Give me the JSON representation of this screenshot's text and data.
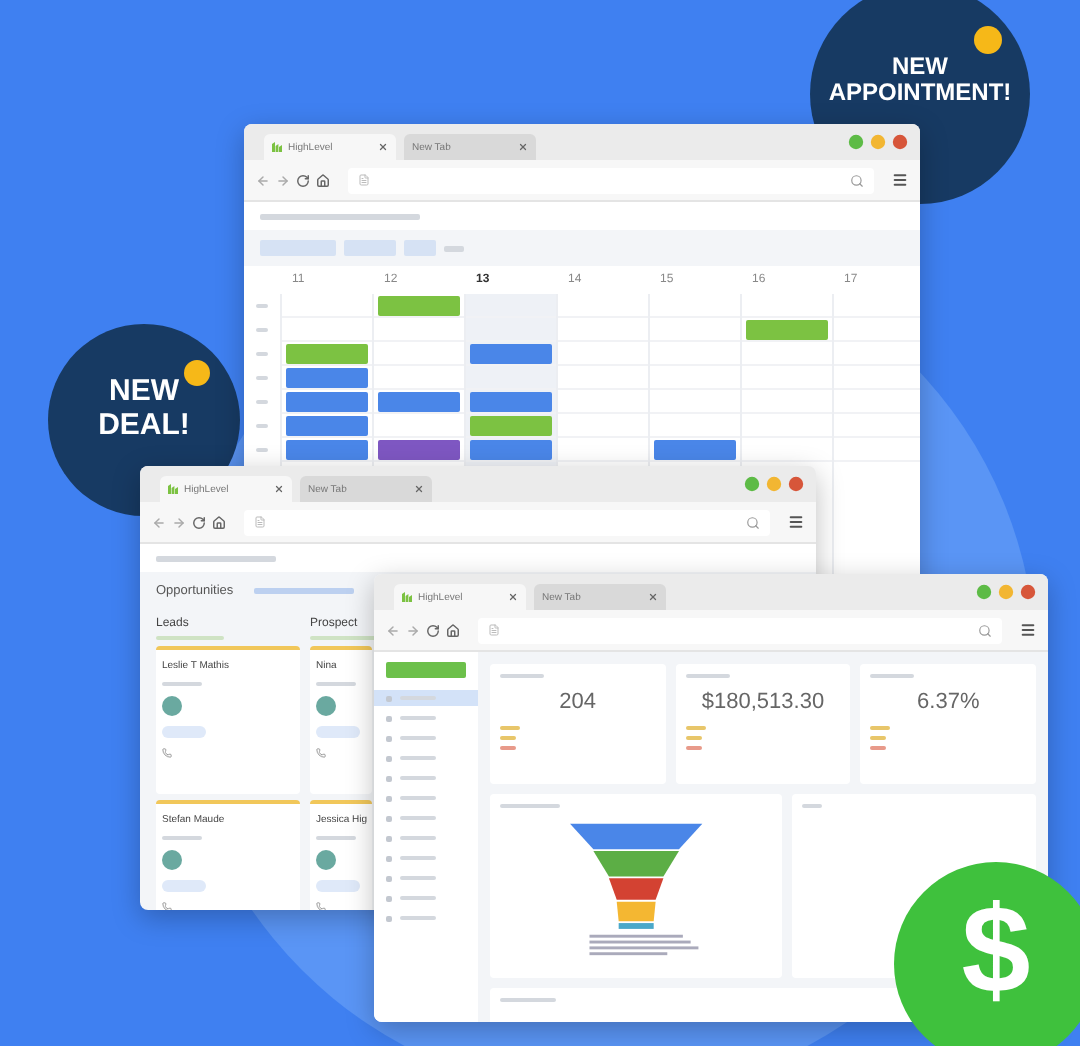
{
  "callouts": [
    {
      "lines": [
        "NEW",
        "APPOINTMENT!"
      ],
      "kind": "appointment"
    },
    {
      "lines": [
        "NEW",
        "DEAL!"
      ],
      "kind": "deal"
    }
  ],
  "windows": [
    {
      "kind": "calendar",
      "tabs": [
        {
          "label": "HighLevel",
          "favicon": true,
          "selected": true
        },
        {
          "label": "New Tab",
          "favicon": false,
          "selected": false
        }
      ],
      "calendar": {
        "days": [
          {
            "day": "11",
            "today": false,
            "slots": [
              {
                "kind": "free"
              },
              {
                "kind": "free"
              },
              {
                "kind": "event",
                "color": "#7cc242"
              },
              {
                "kind": "event",
                "color": "#4a86e8"
              },
              {
                "kind": "event",
                "color": "#4a86e8"
              },
              {
                "kind": "event",
                "color": "#4a86e8"
              },
              {
                "kind": "event",
                "color": "#4a86e8"
              }
            ]
          },
          {
            "day": "12",
            "today": false,
            "slots": [
              {
                "kind": "event",
                "color": "#7cc242"
              },
              {
                "kind": "free"
              },
              {
                "kind": "free"
              },
              {
                "kind": "free"
              },
              {
                "kind": "event",
                "color": "#4a86e8"
              },
              {
                "kind": "free"
              },
              {
                "kind": "event",
                "color": "#7e57c2"
              }
            ]
          },
          {
            "day": "13",
            "today": true,
            "slots": [
              {
                "kind": "free"
              },
              {
                "kind": "free"
              },
              {
                "kind": "event",
                "color": "#4a86e8"
              },
              {
                "kind": "free"
              },
              {
                "kind": "event",
                "color": "#4a86e8"
              },
              {
                "kind": "event",
                "color": "#7cc242"
              },
              {
                "kind": "event",
                "color": "#4a86e8"
              }
            ]
          },
          {
            "day": "14",
            "today": false,
            "slots": [
              {
                "kind": "free"
              },
              {
                "kind": "free"
              },
              {
                "kind": "free"
              },
              {
                "kind": "free"
              },
              {
                "kind": "free"
              },
              {
                "kind": "free"
              },
              {
                "kind": "free"
              }
            ]
          },
          {
            "day": "15",
            "today": false,
            "slots": [
              {
                "kind": "free"
              },
              {
                "kind": "free"
              },
              {
                "kind": "free"
              },
              {
                "kind": "free"
              },
              {
                "kind": "free"
              },
              {
                "kind": "free"
              },
              {
                "kind": "event",
                "color": "#4a86e8"
              }
            ]
          },
          {
            "day": "16",
            "today": false,
            "slots": [
              {
                "kind": "free"
              },
              {
                "kind": "event",
                "color": "#7cc242"
              },
              {
                "kind": "free"
              },
              {
                "kind": "free"
              },
              {
                "kind": "free"
              },
              {
                "kind": "free"
              },
              {
                "kind": "free"
              }
            ]
          },
          {
            "day": "17",
            "today": false,
            "slots": [
              {
                "kind": "free"
              },
              {
                "kind": "free"
              },
              {
                "kind": "free"
              },
              {
                "kind": "free"
              },
              {
                "kind": "free"
              },
              {
                "kind": "free"
              },
              {
                "kind": "free"
              }
            ]
          }
        ]
      }
    },
    {
      "kind": "pipeline",
      "tabs": [
        {
          "label": "HighLevel",
          "favicon": true,
          "selected": true
        },
        {
          "label": "New Tab",
          "favicon": false,
          "selected": false
        }
      ],
      "pipeline": {
        "title": "Opportunities",
        "stages": [
          {
            "name": "Leads",
            "cards": [
              {
                "name": "Leslie T Mathis"
              },
              {
                "name": "Stefan Maude"
              }
            ]
          },
          {
            "name": "Prospect",
            "cards": [
              {
                "name": "Nina"
              },
              {
                "name": "Jessica Hig"
              }
            ]
          }
        ]
      }
    },
    {
      "kind": "dashboard",
      "tabs": [
        {
          "label": "HighLevel",
          "favicon": true,
          "selected": true
        },
        {
          "label": "New Tab",
          "favicon": false,
          "selected": false
        }
      ],
      "dashboard": {
        "nav": [
          {
            "selected": true
          },
          {
            "selected": false
          },
          {
            "selected": false
          },
          {
            "selected": false
          },
          {
            "selected": false
          },
          {
            "selected": false
          },
          {
            "selected": false
          },
          {
            "selected": false
          },
          {
            "selected": false
          },
          {
            "selected": false
          },
          {
            "selected": false
          },
          {
            "selected": false
          }
        ],
        "stats": [
          {
            "value": "204"
          },
          {
            "value": "$180,513.30"
          },
          {
            "value": "6.37%"
          }
        ]
      }
    }
  ],
  "badge": {
    "symbol": "$"
  }
}
